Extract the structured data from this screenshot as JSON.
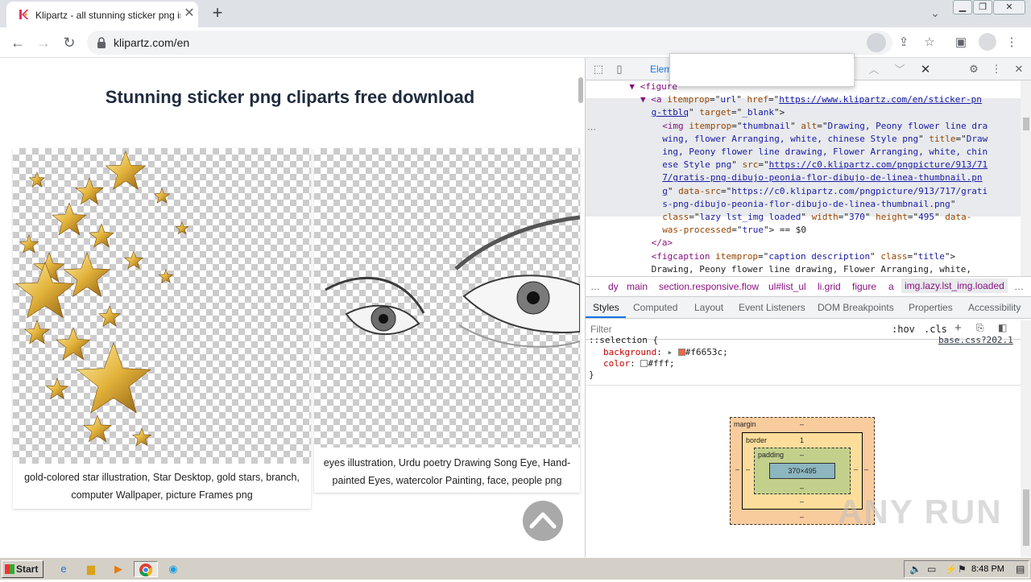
{
  "browser": {
    "tab_title": "Klipartz - all stunning sticker png ima",
    "url": "klipartz.com/en"
  },
  "page": {
    "heading": "Stunning sticker png cliparts free download",
    "cards": [
      {
        "caption": "gold-colored star illustration, Star Desktop, gold stars, branch, computer Wallpaper, picture Frames png"
      },
      {
        "caption": "eyes illustration, Urdu poetry Drawing Song Eye, Hand-painted Eyes, watercolor Painting, face, people png"
      }
    ]
  },
  "devtools": {
    "active_tab_partial": "Elem",
    "code_lines": [
      {
        "indent": 8,
        "parts": [
          [
            "tg",
            "▼ <figure"
          ]
        ]
      },
      {
        "indent": 10,
        "parts": [
          [
            "tg",
            "▼ <a "
          ],
          [
            "at",
            "itemprop"
          ],
          [
            "tx",
            "=\""
          ],
          [
            "av",
            "url"
          ],
          [
            "tx",
            "\" "
          ],
          [
            "at",
            "href"
          ],
          [
            "tx",
            "=\""
          ],
          [
            "lk",
            "https://www.klipartz.com/en/sticker-pn"
          ]
        ]
      },
      {
        "indent": 12,
        "parts": [
          [
            "lk",
            "g-ttblq"
          ],
          [
            "tx",
            "\" "
          ],
          [
            "at",
            "target"
          ],
          [
            "tx",
            "=\""
          ],
          [
            "av",
            "_blank"
          ],
          [
            "tx",
            "\">"
          ]
        ]
      },
      {
        "indent": 14,
        "sel": true,
        "parts": [
          [
            "tg",
            "<img "
          ],
          [
            "at",
            "itemprop"
          ],
          [
            "tx",
            "=\""
          ],
          [
            "av",
            "thumbnail"
          ],
          [
            "tx",
            "\" "
          ],
          [
            "at",
            "alt"
          ],
          [
            "tx",
            "=\""
          ],
          [
            "av",
            "Drawing, Peony flower line dra"
          ]
        ]
      },
      {
        "indent": 14,
        "sel": true,
        "parts": [
          [
            "av",
            "wing, flower Arranging, white, chinese Style png"
          ],
          [
            "tx",
            "\" "
          ],
          [
            "at",
            "title"
          ],
          [
            "tx",
            "=\""
          ],
          [
            "av",
            "Draw"
          ]
        ]
      },
      {
        "indent": 14,
        "sel": true,
        "parts": [
          [
            "av",
            "ing, Peony flower line drawing, Flower Arranging, white, chin"
          ]
        ]
      },
      {
        "indent": 14,
        "sel": true,
        "parts": [
          [
            "av",
            "ese Style png"
          ],
          [
            "tx",
            "\" "
          ],
          [
            "at",
            "src"
          ],
          [
            "tx",
            "=\""
          ],
          [
            "lk",
            "https://c0.klipartz.com/pngpicture/913/71"
          ]
        ]
      },
      {
        "indent": 14,
        "sel": true,
        "parts": [
          [
            "lk",
            "7/gratis-png-dibujo-peonia-flor-dibujo-de-linea-thumbnail.pn"
          ]
        ]
      },
      {
        "indent": 14,
        "sel": true,
        "parts": [
          [
            "lk",
            "g"
          ],
          [
            "tx",
            "\" "
          ],
          [
            "at",
            "data-src"
          ],
          [
            "tx",
            "=\""
          ],
          [
            "av",
            "https://c0.klipartz.com/pngpicture/913/717/grati"
          ]
        ]
      },
      {
        "indent": 14,
        "sel": true,
        "parts": [
          [
            "av",
            "s-png-dibujo-peonia-flor-dibujo-de-linea-thumbnail.png"
          ],
          [
            "tx",
            "\""
          ]
        ]
      },
      {
        "indent": 14,
        "sel": true,
        "parts": [
          [
            "at",
            "class"
          ],
          [
            "tx",
            "=\""
          ],
          [
            "av",
            "lazy lst_img loaded"
          ],
          [
            "tx",
            "\" "
          ],
          [
            "at",
            "width"
          ],
          [
            "tx",
            "=\""
          ],
          [
            "av",
            "370"
          ],
          [
            "tx",
            "\" "
          ],
          [
            "at",
            "height"
          ],
          [
            "tx",
            "=\""
          ],
          [
            "av",
            "495"
          ],
          [
            "tx",
            "\" "
          ],
          [
            "at",
            "data-"
          ]
        ]
      },
      {
        "indent": 14,
        "sel": true,
        "parts": [
          [
            "at",
            "was-processed"
          ],
          [
            "tx",
            "=\""
          ],
          [
            "av",
            "true"
          ],
          [
            "tx",
            "\"> == $0"
          ]
        ]
      },
      {
        "indent": 12,
        "parts": [
          [
            "tg",
            "</a>"
          ]
        ]
      },
      {
        "indent": 12,
        "parts": [
          [
            "tg",
            "<figcaption "
          ],
          [
            "at",
            "itemprop"
          ],
          [
            "tx",
            "=\""
          ],
          [
            "av",
            "caption description"
          ],
          [
            "tx",
            "\" "
          ],
          [
            "at",
            "class"
          ],
          [
            "tx",
            "=\""
          ],
          [
            "av",
            "title"
          ],
          [
            "tx",
            "\">"
          ]
        ]
      },
      {
        "indent": 12,
        "parts": [
          [
            "tx",
            "Drawing, Peony flower line drawing, Flower Arranging, white,"
          ]
        ]
      }
    ],
    "crumbs": [
      "…",
      "dy",
      "main",
      "section.responsive.flow",
      "ul#list_ul",
      "li.grid",
      "figure",
      "a",
      "img.lazy.lst_img.loaded",
      "…"
    ],
    "style_tabs": [
      "Styles",
      "Computed",
      "Layout",
      "Event Listeners",
      "DOM Breakpoints",
      "Properties",
      "Accessibility"
    ],
    "filter_placeholder": "Filter",
    "filter_hov": ":hov",
    "filter_cls": ".cls",
    "rule_selector": "::selection {",
    "rule_source": "base.css?202.1",
    "rule_props": [
      {
        "name": "background",
        "value": "#f6653c",
        "swatch": "#f6653c"
      },
      {
        "name": "color",
        "value": "#fff",
        "swatch": "#ffffff"
      }
    ],
    "rule_close": "}",
    "box_model": {
      "margin_label": "margin",
      "margin_value": "–",
      "border_label": "border",
      "border_value": "1",
      "padding_label": "padding",
      "padding_value": "–",
      "content": "370×495",
      "side_value": "–"
    }
  },
  "taskbar": {
    "start_label": "Start",
    "clock": "8:48 PM"
  },
  "watermark": "ANY RUN"
}
